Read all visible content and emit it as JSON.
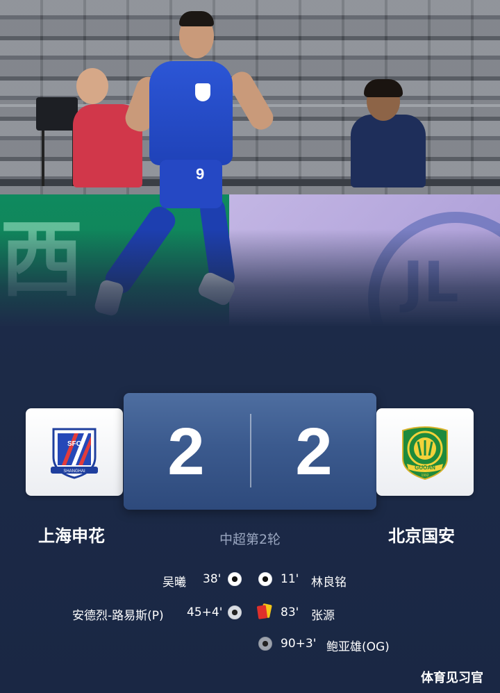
{
  "match": {
    "competition": "中超第2轮",
    "home": {
      "name": "上海申花",
      "score": "2",
      "crest_icon": "shenhua-crest-icon",
      "crest_text": "SFC",
      "crest_caption": "SHANGHAI"
    },
    "away": {
      "name": "北京国安",
      "score": "2",
      "crest_icon": "guoan-crest-icon",
      "crest_text": "GUOAN",
      "crest_year": "1992"
    }
  },
  "events": [
    {
      "side": "home",
      "player": "吴曦",
      "minute": "38'",
      "icon": "soccer-ball-icon"
    },
    {
      "side": "away",
      "player": "林良铭",
      "minute": "11'",
      "icon": "soccer-ball-icon"
    },
    {
      "side": "home",
      "player": "安德烈-路易斯(P)",
      "minute": "45+4'",
      "icon": "penalty-ball-icon"
    },
    {
      "side": "away",
      "player": "张源",
      "minute": "83'",
      "icon": "second-yellow-red-card-icon"
    },
    {
      "side": "away",
      "player": "鲍亚雄(OG)",
      "minute": "90+3'",
      "icon": "own-goal-ball-icon"
    }
  ],
  "photo": {
    "player_number": "9",
    "board_char": "西",
    "board_logo": "JL"
  },
  "watermark": "体育见习官",
  "colors": {
    "background": "#1c2a47",
    "scoreboard": "#3b5a8e",
    "score_text": "#ffffff",
    "competition_text": "#9aa6c0",
    "shenhua_blue": "#1f42b8",
    "guoan_green": "#1e8a3c"
  }
}
